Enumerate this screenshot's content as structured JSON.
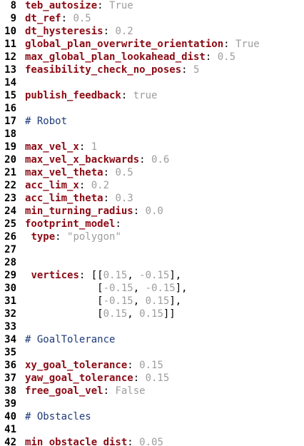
{
  "lines": [
    {
      "no": "8",
      "indent": "",
      "key": "teb_autosize",
      "sep": ": ",
      "value": "True"
    },
    {
      "no": "9",
      "indent": "",
      "key": "dt_ref",
      "sep": ": ",
      "value": "0.5"
    },
    {
      "no": "10",
      "indent": "",
      "key": "dt_hysteresis",
      "sep": ": ",
      "value": "0.2"
    },
    {
      "no": "11",
      "indent": "",
      "key": "global_plan_overwrite_orientation",
      "sep": ": ",
      "value": "True"
    },
    {
      "no": "12",
      "indent": "",
      "key": "max_global_plan_lookahead_dist",
      "sep": ": ",
      "value": "0.5"
    },
    {
      "no": "13",
      "indent": "",
      "key": "feasibility_check_no_poses",
      "sep": ": ",
      "value": "5"
    },
    {
      "no": "14"
    },
    {
      "no": "15",
      "indent": "",
      "key": "publish_feedback",
      "sep": ": ",
      "value": "true"
    },
    {
      "no": "16"
    },
    {
      "no": "17",
      "comment": "# Robot"
    },
    {
      "no": "18"
    },
    {
      "no": "19",
      "indent": "",
      "key": "max_vel_x",
      "sep": ": ",
      "value": "1"
    },
    {
      "no": "20",
      "indent": "",
      "key": "max_vel_x_backwards",
      "sep": ": ",
      "value": "0.6"
    },
    {
      "no": "21",
      "indent": "",
      "key": "max_vel_theta",
      "sep": ": ",
      "value": "0.5"
    },
    {
      "no": "22",
      "indent": "",
      "key": "acc_lim_x",
      "sep": ": ",
      "value": "0.2"
    },
    {
      "no": "23",
      "indent": "",
      "key": "acc_lim_theta",
      "sep": ": ",
      "value": "0.3"
    },
    {
      "no": "24",
      "indent": "",
      "key": "min_turning_radius",
      "sep": ": ",
      "value": "0.0"
    },
    {
      "no": "25",
      "indent": "",
      "key": "footprint_model",
      "sep": ":",
      "value": ""
    },
    {
      "no": "26",
      "indent": " ",
      "key": "type",
      "sep": ": ",
      "value": "\"polygon\""
    },
    {
      "no": "27"
    },
    {
      "no": "28"
    },
    {
      "no": "29",
      "indent": " ",
      "key": "vertices",
      "sep": ": ",
      "value": "",
      "value_parts": [
        {
          "t": "[[",
          "c": "punct"
        },
        {
          "t": "0.15",
          "c": "val"
        },
        {
          "t": ", ",
          "c": "punct"
        },
        {
          "t": "-0.15",
          "c": "val"
        },
        {
          "t": "],",
          "c": "punct"
        }
      ]
    },
    {
      "no": "30",
      "parts": [
        {
          "t": "            [",
          "c": "punct"
        },
        {
          "t": "-0.15",
          "c": "val"
        },
        {
          "t": ", ",
          "c": "punct"
        },
        {
          "t": "-0.15",
          "c": "val"
        },
        {
          "t": "],",
          "c": "punct"
        }
      ]
    },
    {
      "no": "31",
      "parts": [
        {
          "t": "            [",
          "c": "punct"
        },
        {
          "t": "-0.15",
          "c": "val"
        },
        {
          "t": ", ",
          "c": "punct"
        },
        {
          "t": "0.15",
          "c": "val"
        },
        {
          "t": "],",
          "c": "punct"
        }
      ]
    },
    {
      "no": "32",
      "parts": [
        {
          "t": "            [",
          "c": "punct"
        },
        {
          "t": "0.15",
          "c": "val"
        },
        {
          "t": ", ",
          "c": "punct"
        },
        {
          "t": "0.15",
          "c": "val"
        },
        {
          "t": "]]",
          "c": "punct"
        }
      ]
    },
    {
      "no": "33"
    },
    {
      "no": "34",
      "comment": "# GoalTolerance"
    },
    {
      "no": "35"
    },
    {
      "no": "36",
      "indent": "",
      "key": "xy_goal_tolerance",
      "sep": ": ",
      "value": "0.15"
    },
    {
      "no": "37",
      "indent": "",
      "key": "yaw_goal_tolerance",
      "sep": ": ",
      "value": "0.15"
    },
    {
      "no": "38",
      "indent": "",
      "key": "free_goal_vel",
      "sep": ": ",
      "value": "False"
    },
    {
      "no": "39"
    },
    {
      "no": "40",
      "comment": "# Obstacles"
    },
    {
      "no": "41"
    },
    {
      "no": "42",
      "indent": "",
      "key": "min_obstacle_dist",
      "sep": ": ",
      "value": "0.05"
    }
  ]
}
